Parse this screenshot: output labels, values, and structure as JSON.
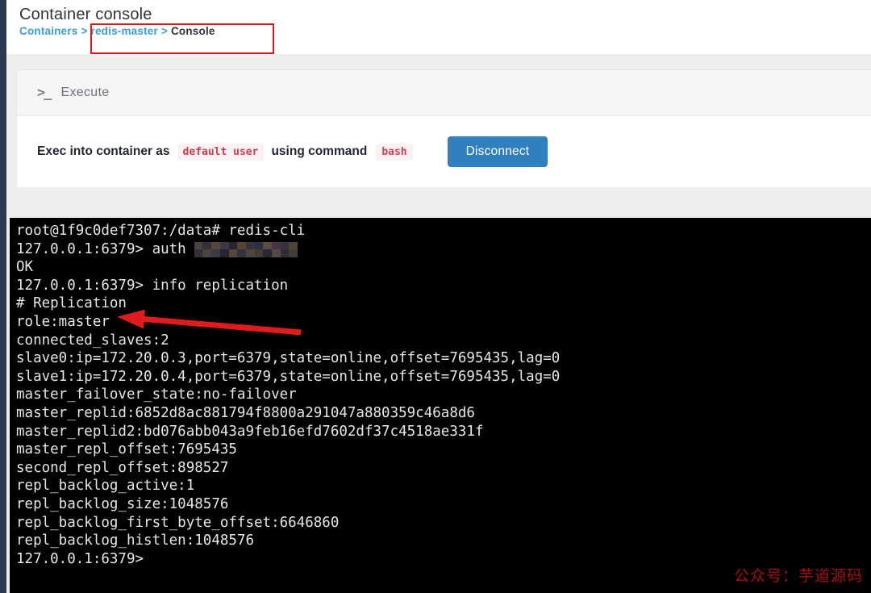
{
  "page": {
    "title": "Container console",
    "breadcrumb": {
      "separator": ">",
      "items": [
        {
          "label": "Containers",
          "type": "link"
        },
        {
          "label": "redis-master",
          "type": "link"
        },
        {
          "label": "Console",
          "type": "current"
        }
      ]
    }
  },
  "execute_panel": {
    "header": {
      "icon_glyph": ">_",
      "label": "Execute"
    },
    "body": {
      "text_prefix": "Exec into container as",
      "user_code": "default user",
      "text_middle": "using command",
      "command_code": "bash",
      "disconnect_label": "Disconnect"
    }
  },
  "terminal": {
    "lines": [
      {
        "text": "root@1f9c0def7307:/data# redis-cli"
      },
      {
        "text": "127.0.0.1:6379> auth",
        "redacted": true
      },
      {
        "text": "OK"
      },
      {
        "text": "127.0.0.1:6379> info replication"
      },
      {
        "text": "# Replication"
      },
      {
        "text": "role:master"
      },
      {
        "text": "connected_slaves:2"
      },
      {
        "text": "slave0:ip=172.20.0.3,port=6379,state=online,offset=7695435,lag=0"
      },
      {
        "text": "slave1:ip=172.20.0.4,port=6379,state=online,offset=7695435,lag=0"
      },
      {
        "text": "master_failover_state:no-failover"
      },
      {
        "text": "master_replid:6852d8ac881794f8800a291047a880359c46a8d6"
      },
      {
        "text": "master_replid2:bd076abb043a9feb16efd7602df37c4518ae331f"
      },
      {
        "text": "master_repl_offset:7695435"
      },
      {
        "text": "second_repl_offset:898527"
      },
      {
        "text": "repl_backlog_active:1"
      },
      {
        "text": "repl_backlog_size:1048576"
      },
      {
        "text": "repl_backlog_first_byte_offset:6646860"
      },
      {
        "text": "repl_backlog_histlen:1048576"
      },
      {
        "text": "127.0.0.1:6379>"
      }
    ],
    "watermark": "公众号：芋道源码"
  },
  "colors": {
    "left_bar": "#2d3a52",
    "breadcrumb_link": "#3b9fd0",
    "button_blue": "#3080c0",
    "code_red": "#cf3c56",
    "annotation_red": "#d7191f",
    "arrow_red": "#e11a1d",
    "terminal_bg": "#000000",
    "terminal_text": "#e6e6e2",
    "watermark_red": "#a60f0f"
  }
}
